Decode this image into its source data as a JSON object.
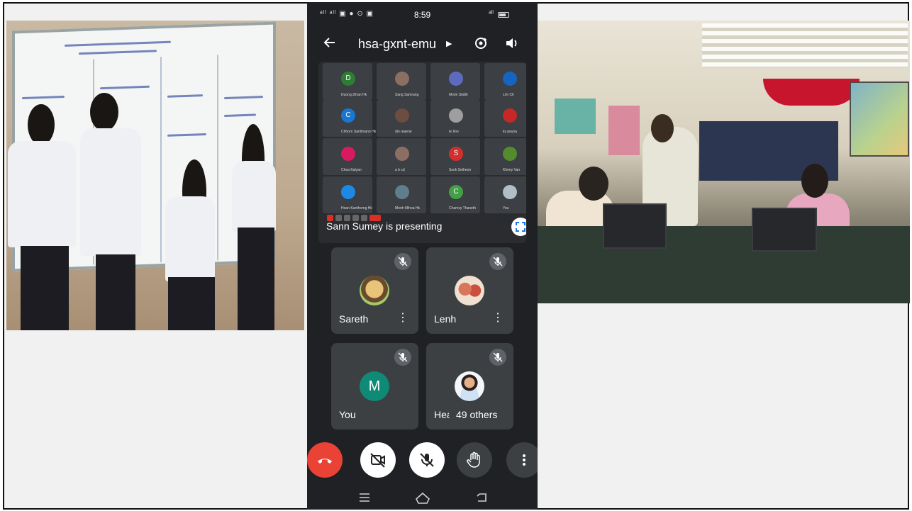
{
  "status_bar": {
    "icons_left": "ᵃˡˡ ᵃˡˡ ▣ ● ⊙ ▣",
    "time": "8:59",
    "icons_right": "ᵃˡˡ"
  },
  "meet": {
    "meeting_code": "hsa-gxnt-emu",
    "presenter_label": "Sann Sumey is presenting",
    "others_label": "49 others"
  },
  "grid_thumbnails": [
    {
      "initial": "D",
      "color": "#2e7d32",
      "name": "Duong Zihan Hk"
    },
    {
      "initial": "",
      "color": "#8d6e63",
      "name": "Sang Samrang"
    },
    {
      "initial": "",
      "color": "#5c6bc0",
      "name": "Morin Sitdth"
    },
    {
      "initial": "",
      "color": "#1565c0",
      "name": "Lim Ch"
    },
    {
      "initial": "C",
      "color": "#1976d2",
      "name": "Chhorn Santhvann Hk"
    },
    {
      "initial": "",
      "color": "#6d4c41",
      "name": "din reaene"
    },
    {
      "initial": "",
      "color": "#9e9e9e",
      "name": "Ie Ilon"
    },
    {
      "initial": "",
      "color": "#c62828",
      "name": "ks peyna"
    },
    {
      "initial": "",
      "color": "#d81b60",
      "name": "Chea Kalyan"
    },
    {
      "initial": "",
      "color": "#8d6e63",
      "name": "a b cd"
    },
    {
      "initial": "S",
      "color": "#d32f2f",
      "name": "Suok Seiheon"
    },
    {
      "initial": "",
      "color": "#558b2f",
      "name": "Kheny Van"
    },
    {
      "initial": "",
      "color": "#1e88e5",
      "name": "Hean Kanthorng Hk"
    },
    {
      "initial": "",
      "color": "#607d8b",
      "name": "Monh Mihoa Hk"
    },
    {
      "initial": "C",
      "color": "#43a047",
      "name": "Chamsy Thaneth"
    },
    {
      "initial": "",
      "color": "#b0bec5",
      "name": "You"
    }
  ],
  "participants": [
    {
      "name": "Sareth",
      "avatar_color": "#b08a57"
    },
    {
      "name": "Lenh",
      "avatar_color": "#c9825e"
    },
    {
      "name": "You",
      "avatar_initial": "M",
      "avatar_color": "#0f8a76"
    },
    {
      "name": "Hea",
      "avatar_color": "#dfe8f2"
    }
  ],
  "controls": [
    {
      "name": "end-call",
      "color": "#ea4335"
    },
    {
      "name": "camera-off",
      "color": "#ffffff"
    },
    {
      "name": "mic-off",
      "color": "#ffffff"
    },
    {
      "name": "raise-hand",
      "color": "#3c4043"
    },
    {
      "name": "more-options",
      "color": "#3c4043"
    }
  ],
  "icons": [
    "back-arrow-icon",
    "chevron-right-icon",
    "switch-camera-icon",
    "speaker-icon",
    "fullscreen-icon",
    "mic-off-icon",
    "more-vert-icon",
    "hand-icon",
    "phone-hangup-icon",
    "video-off-icon",
    "nav-menu-icon",
    "nav-home-icon",
    "nav-back-icon"
  ]
}
